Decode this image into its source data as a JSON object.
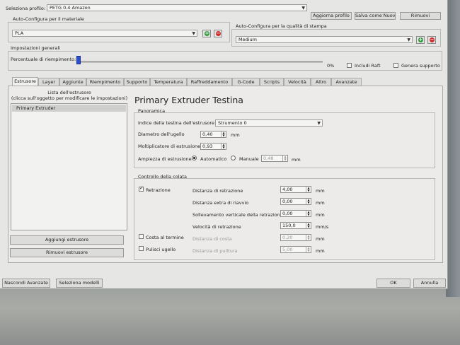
{
  "profile": {
    "label": "Seleziona profilo:",
    "value": "PETG 0.4  Amazon",
    "update_btn": "Aggiorna profilo",
    "save_new_btn": "Salva come Nuovo",
    "remove_btn": "Rimuovi"
  },
  "material": {
    "label": "Auto-Configura per il materiale",
    "value": "PLA"
  },
  "quality": {
    "label": "Auto-Configura per la qualità di stampa",
    "value": "Medium"
  },
  "general": {
    "label": "Impostazioni generali",
    "infill_label": "Percentuale di riempimento:",
    "infill_value": "0%",
    "raft_label": "Includi Raft",
    "support_label": "Genera supporto",
    "infill_fraction": 0.0
  },
  "tabs": [
    "Estrusore",
    "Layer",
    "Aggiunte",
    "Riempimento",
    "Supporto",
    "Temperatura",
    "Raffreddamento",
    "G-Code",
    "Scripts",
    "Velocità",
    "Altro",
    "Avanzate"
  ],
  "extruder_list": {
    "header": "Lista dell'estrusore\n(clicca sull'oggetto per modificare le impostazioni)",
    "items": [
      "Primary Extruder"
    ],
    "add_btn": "Aggiungi estrusore",
    "remove_btn": "Rimuovi estrusore"
  },
  "editor": {
    "title": "Primary Extruder Testina",
    "overview": {
      "label": "Panoramica",
      "toolhead_label": "Indice della testina dell'estrusore",
      "toolhead_value": "Strumento 0",
      "nozzle_label": "Diametro dell'ugello",
      "nozzle_value": "0,40",
      "nozzle_unit": "mm",
      "mult_label": "Moltiplicatore di estrusione",
      "mult_value": "0,93",
      "width_label": "Ampiezza di estrusione",
      "width_auto": "Automatico",
      "width_manual": "Manuale",
      "width_value": "0,48",
      "width_unit": "mm"
    },
    "ooze": {
      "label": "Controllo della colata",
      "retraction_label": "Retrazione",
      "retract_dist_label": "Distanza di retrazione",
      "retract_dist_value": "4,00",
      "retract_dist_unit": "mm",
      "extra_restart_label": "Distanza extra di riavvio",
      "extra_restart_value": "0,00",
      "extra_restart_unit": "mm",
      "vlift_label": "Sollevamento verticale della retrazione",
      "vlift_value": "0,00",
      "vlift_unit": "mm",
      "retract_speed_label": "Velocità di retrazione",
      "retract_speed_value": "150,0",
      "retract_speed_unit": "mm/s",
      "coast_label": "Costa al termine",
      "coast_dist_label": "Distanza di costa",
      "coast_dist_value": "0,20",
      "coast_dist_unit": "mm",
      "wipe_label": "Pulisci ugello",
      "wipe_dist_label": "Distanza di pulitura",
      "wipe_dist_value": "5,00",
      "wipe_dist_unit": "mm"
    }
  },
  "footer": {
    "hide_adv_btn": "Nascondi Avanzate",
    "select_models_btn": "Seleziona modelli",
    "ok_btn": "OK",
    "cancel_btn": "Annulla"
  },
  "colors": {
    "add": "#2e9a3a",
    "remove": "#cc2a2a",
    "slider_handle": "#2a4fd6",
    "list_selected": "#cfcfcd"
  }
}
